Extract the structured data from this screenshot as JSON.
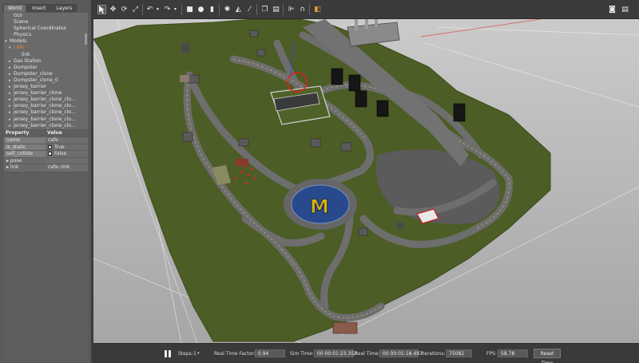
{
  "tabs": [
    "World",
    "Insert",
    "Layers"
  ],
  "tree": [
    {
      "label": "GUI",
      "arrow": "",
      "depth": 1
    },
    {
      "label": "Scene",
      "arrow": "",
      "depth": 1
    },
    {
      "label": "Spherical Coordinates",
      "arrow": "",
      "depth": 1
    },
    {
      "label": "Physics",
      "arrow": "",
      "depth": 1
    },
    {
      "label": "Models",
      "arrow": "▾",
      "depth": 0
    },
    {
      "label": "cafe",
      "arrow": "▾",
      "depth": 1,
      "selected": true
    },
    {
      "label": "link",
      "arrow": "",
      "depth": 3
    },
    {
      "label": "Gas Station",
      "arrow": "▸",
      "depth": 1
    },
    {
      "label": "Dumpster",
      "arrow": "▸",
      "depth": 1
    },
    {
      "label": "Dumpster_clone",
      "arrow": "▸",
      "depth": 1
    },
    {
      "label": "Dumpster_clone_0",
      "arrow": "▸",
      "depth": 1
    },
    {
      "label": "jersey_barrier",
      "arrow": "▸",
      "depth": 1
    },
    {
      "label": "jersey_barrier_clone",
      "arrow": "▸",
      "depth": 1
    },
    {
      "label": "jersey_barrier_clone_clo...",
      "arrow": "▸",
      "depth": 1
    },
    {
      "label": "jersey_barrier_clone_clo...",
      "arrow": "▸",
      "depth": 1
    },
    {
      "label": "jersey_barrier_clone_clo...",
      "arrow": "▸",
      "depth": 1
    },
    {
      "label": "jersey_barrier_clone_clo...",
      "arrow": "▸",
      "depth": 1
    },
    {
      "label": "jersey_barrier_clone_clo...",
      "arrow": "▸",
      "depth": 1
    }
  ],
  "properties": {
    "header": {
      "property": "Property",
      "value": "Value"
    },
    "rows": [
      {
        "key": "name",
        "value": "cafe"
      },
      {
        "key": "is_static",
        "value": "True",
        "checked": true
      },
      {
        "key": "self_collide",
        "value": "False",
        "checked": false
      },
      {
        "key": "pose",
        "value": "",
        "group": true
      },
      {
        "key": "link",
        "value": "cafe::link",
        "group": true
      }
    ]
  },
  "toolbar": {
    "icons": [
      "select-arrow-icon",
      "translate-icon",
      "rotate-icon",
      "scale-icon",
      "undo-icon",
      "undo-dropdown-icon",
      "redo-icon",
      "redo-dropdown-icon",
      "box-icon",
      "sphere-icon",
      "cylinder-icon",
      "point-light-icon",
      "spot-light-icon",
      "directional-light-icon",
      "copy-icon",
      "paste-icon",
      "align-icon",
      "snap-icon",
      "change-view-icon",
      "screenshot-icon",
      "record-icon"
    ]
  },
  "status": {
    "steps_label": "Steps:",
    "steps_value": "1",
    "rtf_label": "Real Time Factor:",
    "rtf_value": "0.94",
    "sim_time_label": "Sim Time:",
    "sim_time_value": "00 00:01:23.352",
    "real_time_label": "Real Time:",
    "real_time_value": "00 00:01:18.497",
    "iterations_label": "Iterations:",
    "iterations_value": "75082",
    "fps_label": "FPS:",
    "fps_value": "58.78",
    "reset_label": "Reset Time"
  },
  "colors": {
    "panel": "#5a5a5a",
    "selected_text": "#f08030",
    "terrain": "#4a5a24",
    "road": "#6c6c6c",
    "roundabout": "#284a8c",
    "selection_ring": "#e02020"
  }
}
